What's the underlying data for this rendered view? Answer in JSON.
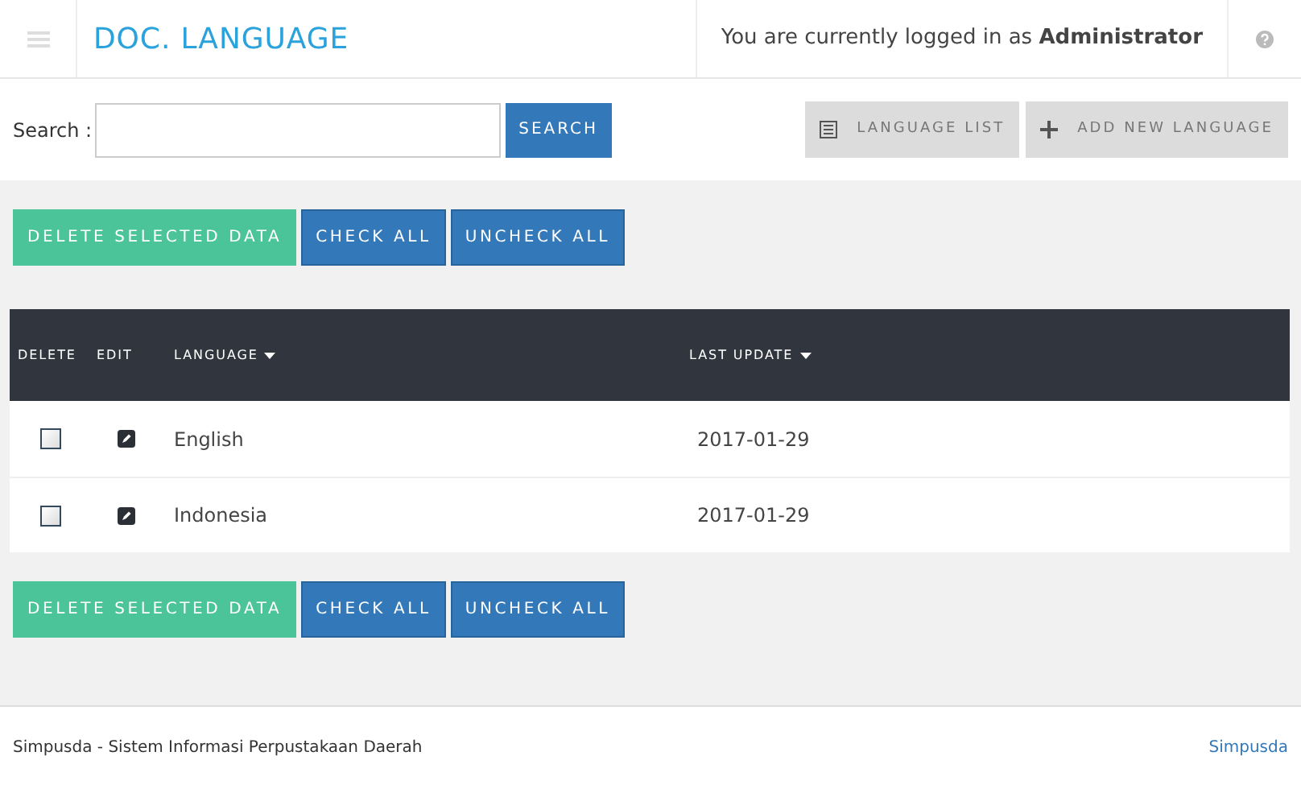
{
  "header": {
    "title": "DOC. LANGUAGE",
    "user_text": "You are currently logged in as **Administrator**"
  },
  "search": {
    "label": "Search :",
    "button": "SEARCH"
  },
  "toolbar": [
    {
      "label": "LANGUAGE LIST",
      "kind": "list"
    },
    {
      "label": "ADD NEW LANGUAGE",
      "kind": "add"
    }
  ],
  "action_bar_top": [
    {
      "label": "DELETE SELECTED DATA",
      "kind": "delete"
    },
    {
      "label": "CHECK ALL",
      "kind": "normal"
    },
    {
      "label": "UNCHECK ALL",
      "kind": "normal"
    }
  ],
  "table": {
    "columns": [
      {
        "label": "DELETE",
        "sortable": false
      },
      {
        "label": "EDIT",
        "sortable": false
      },
      {
        "label": "LANGUAGE",
        "sortable": true
      },
      {
        "label": "LAST UPDATE",
        "sortable": true
      }
    ],
    "rows": [
      {
        "checked": false,
        "language": "English",
        "last_update": "2017-01-29"
      },
      {
        "checked": false,
        "language": "Indonesia",
        "last_update": "2017-01-29"
      }
    ]
  },
  "action_bar_bottom": [
    {
      "label": "DELETE SELECTED DATA",
      "kind": "delete"
    },
    {
      "label": "CHECK ALL",
      "kind": "normal"
    },
    {
      "label": "UNCHECK ALL",
      "kind": "normal"
    }
  ],
  "footer": {
    "text": "Simpusda - Sistem Informasi Perpustakaan Daerah",
    "link": "Simpusda"
  }
}
